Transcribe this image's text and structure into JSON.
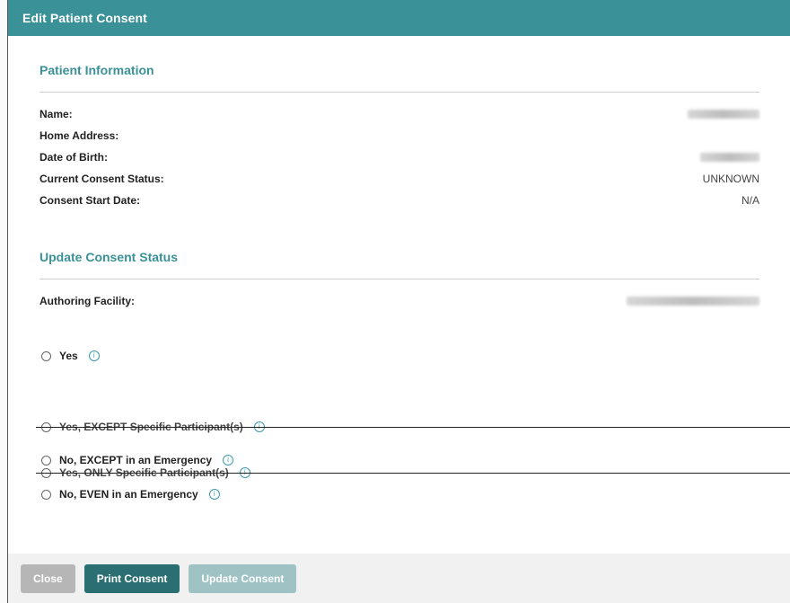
{
  "modal": {
    "title": "Edit Patient Consent"
  },
  "patient_info": {
    "title": "Patient Information",
    "fields": [
      {
        "label": "Name:",
        "value": ""
      },
      {
        "label": "Home Address:",
        "value": ""
      },
      {
        "label": "Date of Birth:",
        "value": ""
      },
      {
        "label": "Current Consent Status:",
        "value": "UNKNOWN"
      },
      {
        "label": "Consent Start Date:",
        "value": "N/A"
      }
    ]
  },
  "update_consent": {
    "title": "Update Consent Status",
    "authoring_facility_label": "Authoring Facility:",
    "options": [
      {
        "label": "Yes",
        "disabled": false
      },
      {
        "label": "Yes, EXCEPT Specific Participant(s)",
        "disabled": true
      },
      {
        "label": "Yes, ONLY Specific Participant(s)",
        "disabled": true
      },
      {
        "label": "No, EXCEPT in an Emergency",
        "disabled": false
      },
      {
        "label": "No, EVEN in an Emergency",
        "disabled": false
      }
    ]
  },
  "footer": {
    "close_label": "Close",
    "print_label": "Print Consent",
    "update_label": "Update Consent"
  },
  "colors": {
    "header_bg": "#3a9197",
    "accent": "#3a9197",
    "print_button": "#2c6f73",
    "update_button_disabled": "#9fc2c5",
    "close_button_disabled": "#b6b6b6"
  },
  "icons": {
    "radio": "radio-icon",
    "info": "info-icon"
  }
}
